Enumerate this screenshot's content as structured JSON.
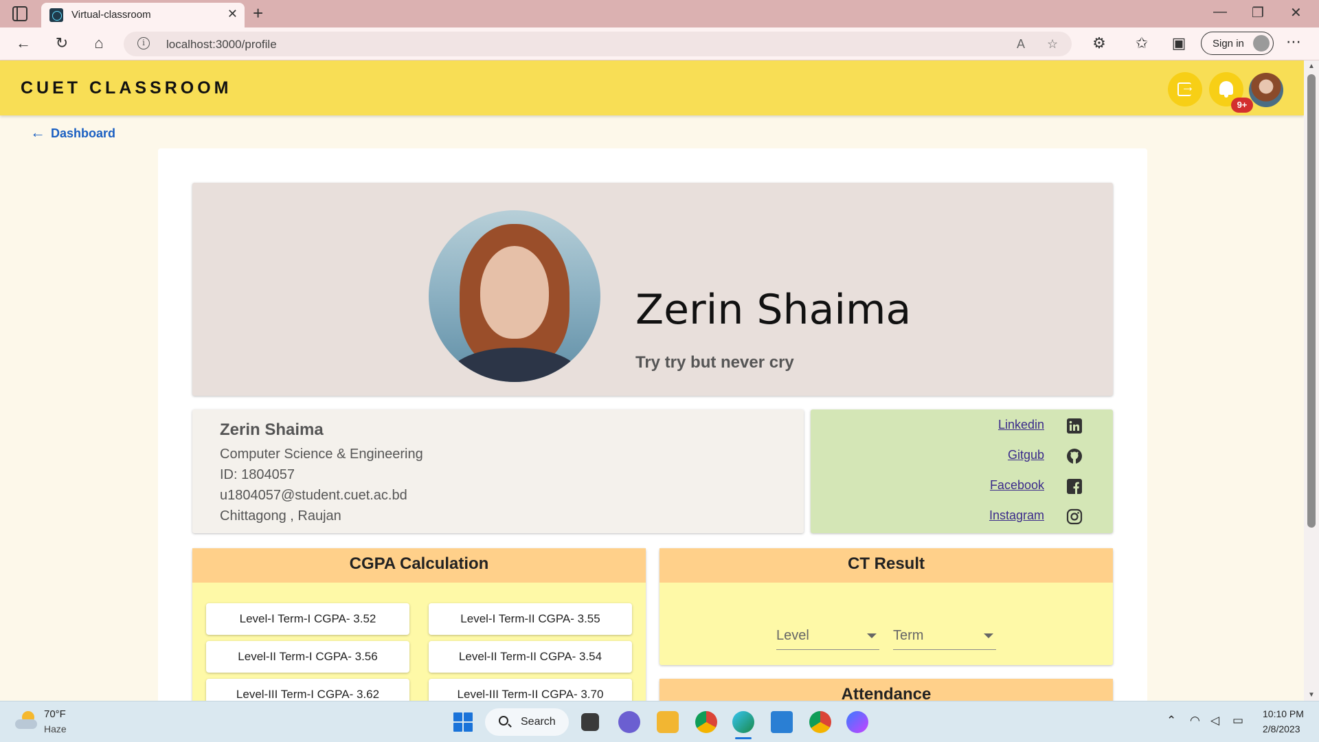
{
  "browser": {
    "tab_title": "Virtual-classroom",
    "url": "localhost:3000/profile",
    "signin_label": "Sign in"
  },
  "header": {
    "brand": "CUET CLASSROOM",
    "notification_count": "9+"
  },
  "nav": {
    "back_label": "Dashboard"
  },
  "profile": {
    "name": "Zerin Shaima",
    "motto": "Try try but never cry"
  },
  "info": {
    "name": "Zerin Shaima",
    "department": "Computer Science & Engineering",
    "id": "ID: 1804057",
    "email": "u1804057@student.cuet.ac.bd",
    "location": "Chittagong , Raujan"
  },
  "social": {
    "links": [
      {
        "label": "Linkedin",
        "icon": "linkedin-icon"
      },
      {
        "label": "Gitgub",
        "icon": "github-icon"
      },
      {
        "label": "Facebook",
        "icon": "facebook-icon"
      },
      {
        "label": "Instagram",
        "icon": "instagram-icon"
      }
    ]
  },
  "cgpa": {
    "title": "CGPA Calculation",
    "items": [
      "Level-I Term-I CGPA- 3.52",
      "Level-I Term-II CGPA- 3.55",
      "Level-II Term-I CGPA- 3.56",
      "Level-II Term-II CGPA- 3.54",
      "Level-III Term-I CGPA- 3.62",
      "Level-III Term-II CGPA- 3.70"
    ]
  },
  "ct_result": {
    "title": "CT Result",
    "level_placeholder": "Level",
    "term_placeholder": "Term"
  },
  "attendance": {
    "title": "Attendance"
  },
  "taskbar": {
    "weather_temp": "70°F",
    "weather_condition": "Haze",
    "search_label": "Search",
    "time": "10:10 PM",
    "date": "2/8/2023"
  },
  "colors": {
    "header_bg": "#f8de55",
    "header_button": "#f7cf16",
    "banner_bg": "#e8dfdb",
    "social_bg": "#d4e6b6",
    "panel_head": "#ffd08a",
    "panel_body": "#fef9a7",
    "link_blue": "#1a5fc2"
  }
}
